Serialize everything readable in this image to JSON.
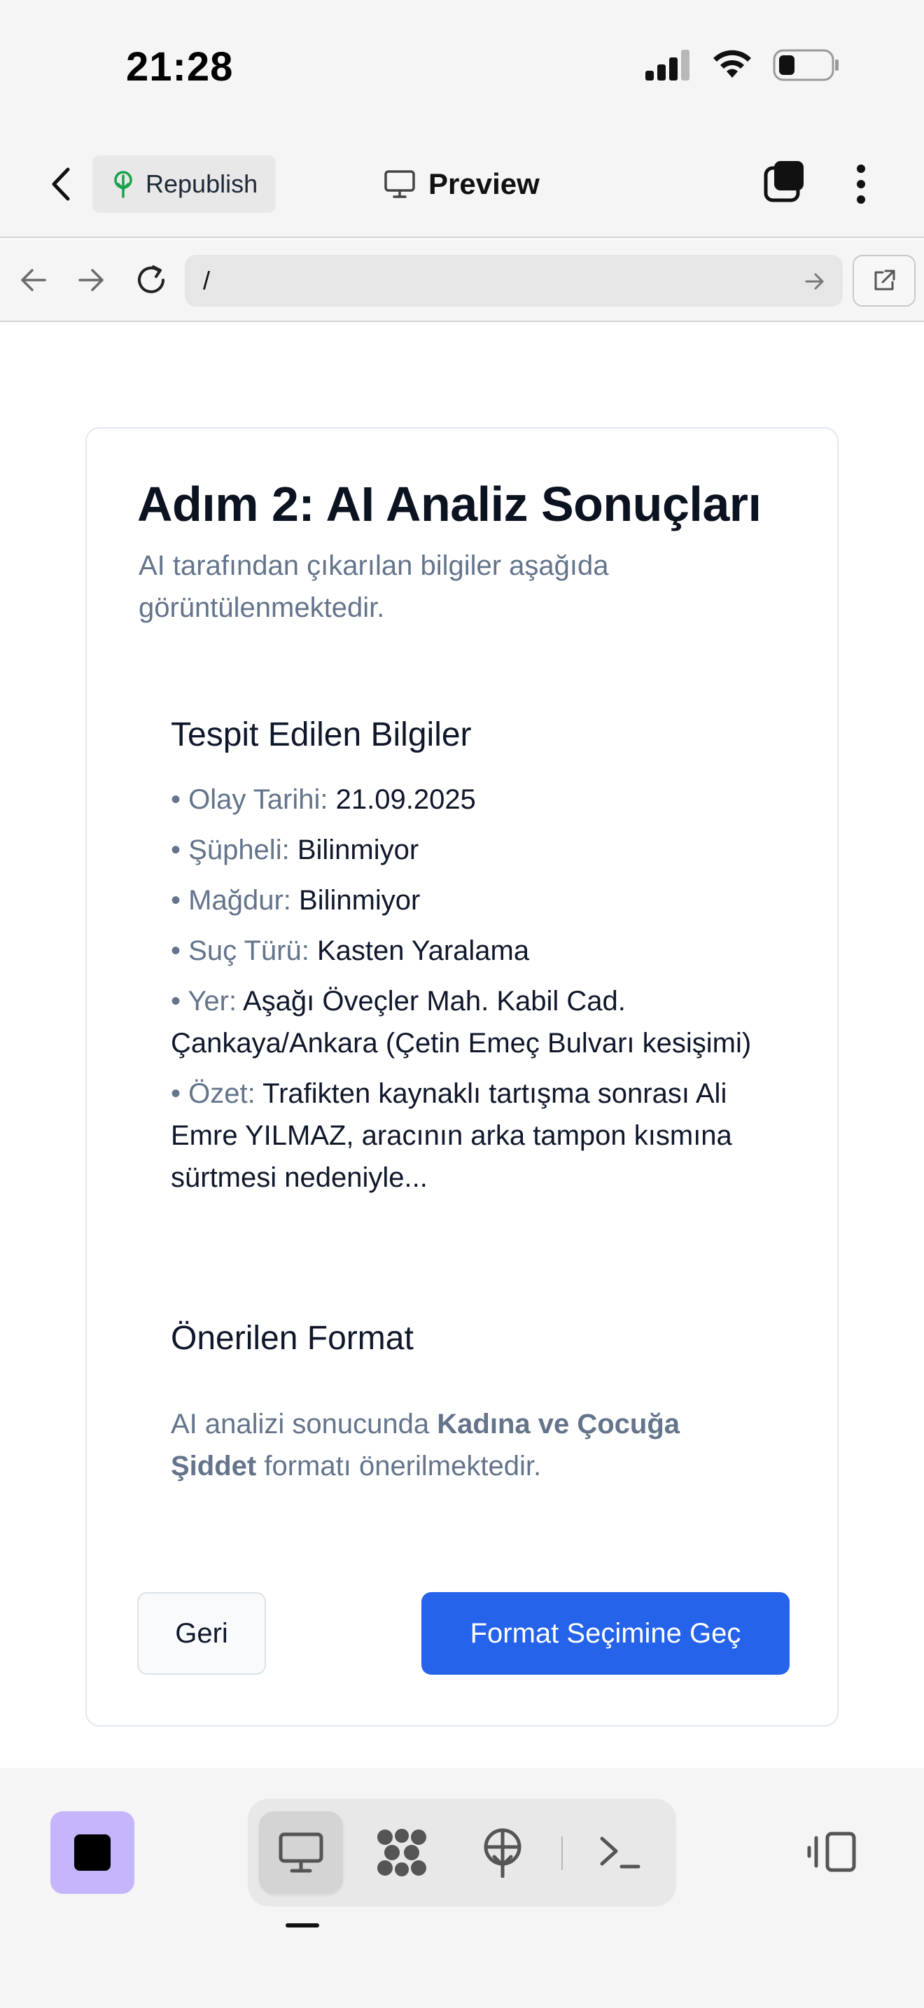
{
  "status_bar": {
    "time": "21:28"
  },
  "header": {
    "republish_label": "Republish",
    "preview_label": "Preview"
  },
  "browser": {
    "url": "/"
  },
  "card": {
    "title": "Adım 2: AI Analiz Sonuçları",
    "subtitle": "AI tarafından çıkarılan bilgiler aşağıda görüntülenmektedir.",
    "detected_section": {
      "title": "Tespit Edilen Bilgiler",
      "items": [
        {
          "bullet": "•",
          "key": "Olay Tarihi:",
          "value": "21.09.2025"
        },
        {
          "bullet": "•",
          "key": "Şüpheli:",
          "value": "Bilinmiyor"
        },
        {
          "bullet": "•",
          "key": "Mağdur:",
          "value": "Bilinmiyor"
        },
        {
          "bullet": "•",
          "key": "Suç Türü:",
          "value": "Kasten Yaralama"
        },
        {
          "bullet": "•",
          "key": "Yer:",
          "value": "Aşağı Öveçler Mah. Kabil Cad. Çankaya/Ankara (Çetin Emeç Bulvarı kesişimi)"
        },
        {
          "bullet": "•",
          "key": "Özet:",
          "value": "Trafikten kaynaklı tartışma sonrası Ali Emre YILMAZ, aracının arka tampon kısmına sürtmesi nedeniyle..."
        }
      ]
    },
    "format_section": {
      "title": "Önerilen Format",
      "text_before": "AI analizi sonucunda",
      "format_name": "Kadına ve Çocuğa Şiddet",
      "text_after": "formatı önerilmektedir."
    },
    "back_button": "Geri",
    "next_button": "Format Seçimine Geç"
  },
  "colors": {
    "primary": "#2563eb",
    "muted_text": "#64748b",
    "stop_button": "#c4b5fd",
    "republish_icon": "#16a34a"
  }
}
